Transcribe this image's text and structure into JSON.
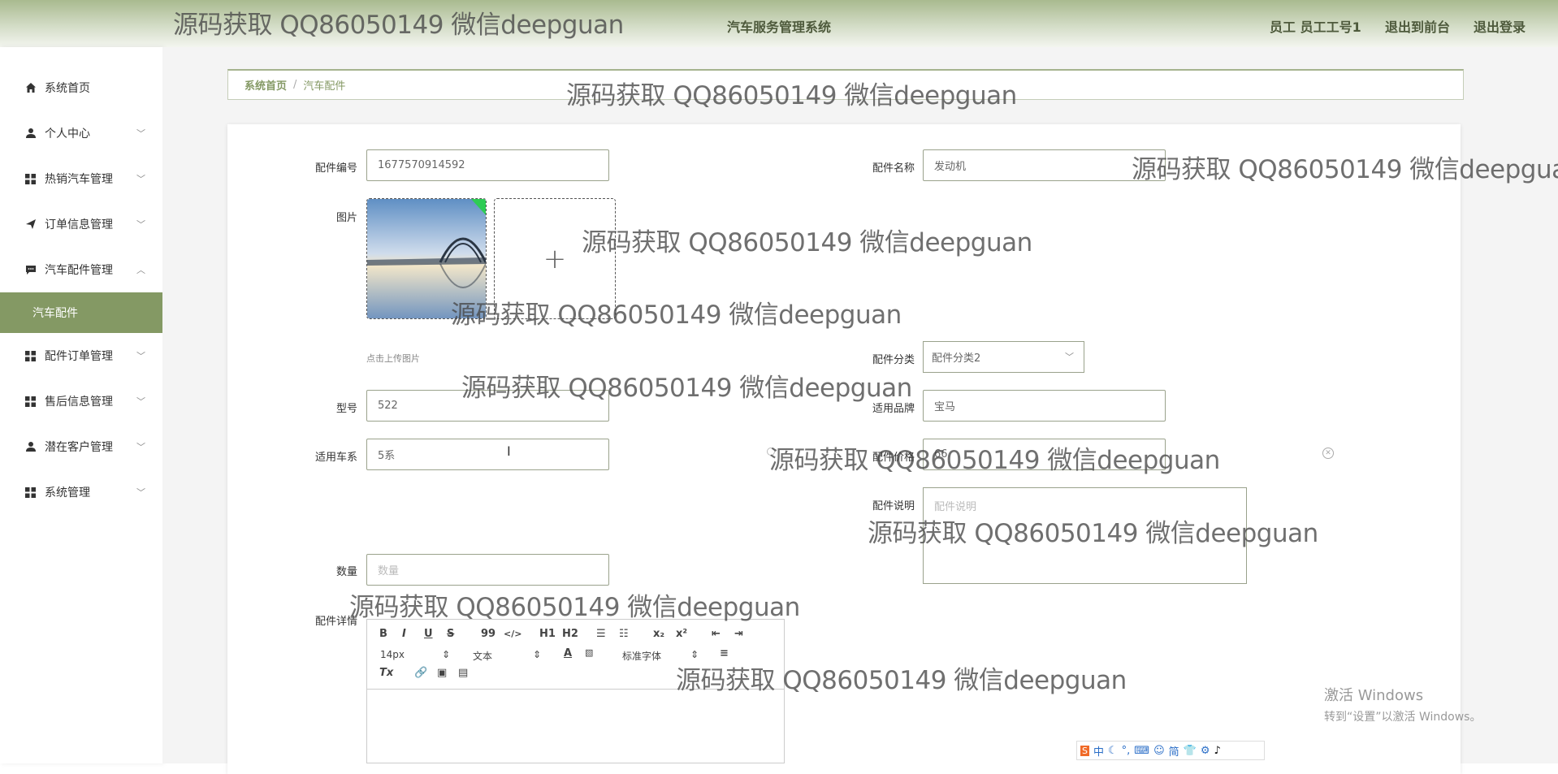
{
  "watermark": "源码获取 QQ86050149 微信deepguan",
  "header": {
    "app_title": "汽车服务管理系统",
    "user_label": "员工 员工工号1",
    "back_frontend": "退出到前台",
    "logout": "退出登录"
  },
  "sidebar": {
    "items": [
      {
        "label": "系统首页",
        "icon": "home-icon"
      },
      {
        "label": "个人中心",
        "icon": "user-icon"
      },
      {
        "label": "热销汽车管理",
        "icon": "grid-icon"
      },
      {
        "label": "订单信息管理",
        "icon": "send-icon"
      },
      {
        "label": "汽车配件管理",
        "icon": "chat-icon"
      },
      {
        "label": "配件订单管理",
        "icon": "grid-icon"
      },
      {
        "label": "售后信息管理",
        "icon": "grid-icon"
      },
      {
        "label": "潜在客户管理",
        "icon": "user-icon"
      },
      {
        "label": "系统管理",
        "icon": "grid-icon"
      }
    ],
    "active_sub": "汽车配件"
  },
  "breadcrumb": {
    "home": "系统首页",
    "separator": "/",
    "current": "汽车配件"
  },
  "form": {
    "part_no": {
      "label": "配件编号",
      "value": "1677570914592"
    },
    "part_name": {
      "label": "配件名称",
      "value": "发动机"
    },
    "image": {
      "label": "图片",
      "upload_tip": "点击上传图片"
    },
    "category": {
      "label": "配件分类",
      "value": "配件分类2"
    },
    "model": {
      "label": "型号",
      "value": "522"
    },
    "brand": {
      "label": "适用品牌",
      "value": "宝马"
    },
    "series": {
      "label": "适用车系",
      "value": "5系"
    },
    "price": {
      "label": "配件价格",
      "value": "66"
    },
    "description": {
      "label": "配件说明",
      "placeholder": "配件说明"
    },
    "quantity": {
      "label": "数量",
      "placeholder": "数量"
    },
    "details": {
      "label": "配件详情"
    }
  },
  "editor": {
    "font_size": "14px",
    "heading": "文本",
    "font_family": "标准字体",
    "buttons": [
      "B",
      "I",
      "U",
      "S",
      "99",
      "</>",
      "H1",
      "H2",
      "ol",
      "ul",
      "x2",
      "x2",
      "outdent",
      "indent"
    ]
  },
  "windows": {
    "activate_title": "激活 Windows",
    "activate_sub": "转到“设置”以激活 Windows。"
  },
  "tray": {
    "ime": "中",
    "simplified": "简"
  },
  "colors": {
    "accent": "#849964",
    "header_text": "#4e5a3c"
  }
}
